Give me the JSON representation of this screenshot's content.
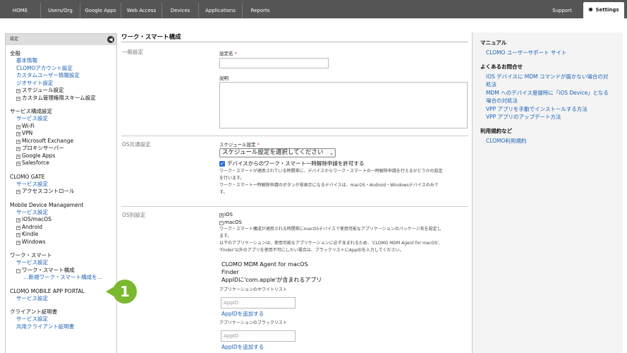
{
  "nav": {
    "tabs": [
      "HOME",
      "Users/Org",
      "Google Apps",
      "Web Access",
      "Devices",
      "Applications",
      "Reports"
    ],
    "support": "Support",
    "settings": "Settings"
  },
  "sidebar": {
    "header": "設定",
    "collapse_glyph": "◀",
    "general": {
      "title": "全般",
      "links": [
        "基本情報",
        "CLOMOアカウント設定",
        "カスタムユーザー情報設定",
        "ジオサイト設定"
      ],
      "trees": [
        "スケジュール設定",
        "カスタム管理権限スキーム設定"
      ]
    },
    "service": {
      "title": "サービス構成設定",
      "link": "サービス設定",
      "trees": [
        "Wi-Fi",
        "VPN",
        "Microsoft Exchange",
        "プロキシサーバー",
        "Google Apps",
        "Salesforce"
      ]
    },
    "gate": {
      "title": "CLOMO GATE",
      "link": "サービス設定",
      "trees": [
        "アクセスコントロール"
      ]
    },
    "mdm": {
      "title": "Mobile Device Management",
      "link": "サービス設定",
      "trees": [
        "iOS/macOS",
        "Android",
        "Kindle",
        "Windows"
      ]
    },
    "work": {
      "title": "ワーク・スマート",
      "link": "サービス設定",
      "tree": "ワーク・スマート構成",
      "sub": "…新規ワーク・スマート構成を…"
    },
    "portal": {
      "title": "CLOMO MOBILE APP PORTAL",
      "link": "サービス設定"
    },
    "cert": {
      "title": "クライアント証明書",
      "links": [
        "サービス設定",
        "共用クライアント証明書"
      ]
    },
    "callout": "1"
  },
  "main": {
    "title": "ワーク・スマート構成",
    "general": {
      "label": "一般設定",
      "name_label": "設定名",
      "required": "*",
      "desc_label": "説明"
    },
    "os_common": {
      "label": "OS共通設定",
      "schedule_label": "スケジュール設定",
      "schedule_value": "スケジュール設定を選択してください",
      "checkbox_label": "デバイスからのワーク・スマート一時解除申請を許可する",
      "note1": "ワーク・スマートが適用されている時間帯に、デバイスからワーク・スマートの一時解除申請を行えるかどうかの設定",
      "note2": "を行います。",
      "note3": "ワーク・スマート一時解除申請のボタンが非表示になるデバイスは、macOS・Android・Windowsデバイスのみで",
      "note4": "す。"
    },
    "os_specific": {
      "label": "OS別設定",
      "ios": "iOS",
      "macos": "macOS",
      "desc1": "ワーク・スマート構成が適用される時間帯にmacOSデバイスで使用可能なアプリケーションのパッケージ名を設定し",
      "desc2": "ます。",
      "desc3": "以下のアプリケーションは、使用可能なアプリケーションに必ず含まれるため、'CLOMO MDM Agent for macOS',",
      "desc4": "'Finder'以外のアプリを使用不可にしたい場合は、ブラックリストにAppIDを入力してください。",
      "app1": "CLOMO MDM Agent for macOS",
      "app2": "Finder",
      "app3": "AppIDに'com.apple'が含まれるアプリ",
      "whitelist_label": "アプリケーションのホワイトリスト",
      "whitelist_placeholder": "AppID",
      "whitelist_add": "AppIDを追加する",
      "blacklist_label": "アプリケーションのブラックリスト",
      "blacklist_placeholder": "AppID",
      "blacklist_add": "AppIDを追加する"
    }
  },
  "right": {
    "manual": "マニュアル",
    "manual_link": "CLOMO ユーザーサポート サイト",
    "faq": "よくあるお問合せ",
    "faq_links": [
      "iOS デバイスに MDM コマンドが届かない場合の対",
      "処法",
      "MDM へのデバイス登録時に「iOS Device」となる",
      "場合の対処法",
      "VPP アプリを手動でインストールする方法",
      "VPP アプリのアップデート方法"
    ],
    "terms": "利用規約など",
    "terms_link": "CLOMO利用規約"
  }
}
